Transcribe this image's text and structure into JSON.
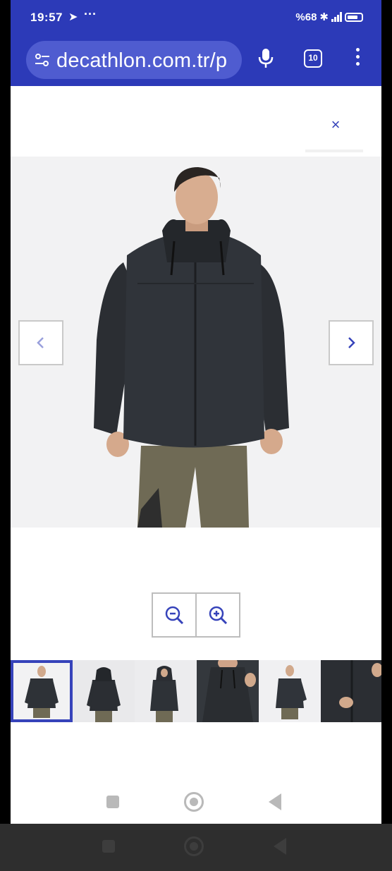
{
  "status_bar": {
    "time": "19:57",
    "right_text": "%68",
    "icons": [
      "navigation-icon",
      "more-dots-icon",
      "bluetooth-icon",
      "signal-icon",
      "battery-icon"
    ]
  },
  "browser": {
    "url": "decathlon.com.tr/p",
    "tab_count": "10",
    "icons": [
      "site-settings-icon",
      "mic-icon",
      "tab-switcher-icon",
      "overflow-menu-icon"
    ]
  },
  "gallery": {
    "close_label": "×",
    "prev_label": "‹",
    "next_label": "›",
    "active_index": 0,
    "thumbnail_count": 6,
    "icons": [
      "close-icon",
      "chevron-left-icon",
      "chevron-right-icon",
      "zoom-out-icon",
      "zoom-in-icon"
    ]
  },
  "colors": {
    "brand_blue": "#3643ba",
    "browser_bar": "#2c3ab8",
    "image_bg": "#f2f2f3"
  }
}
